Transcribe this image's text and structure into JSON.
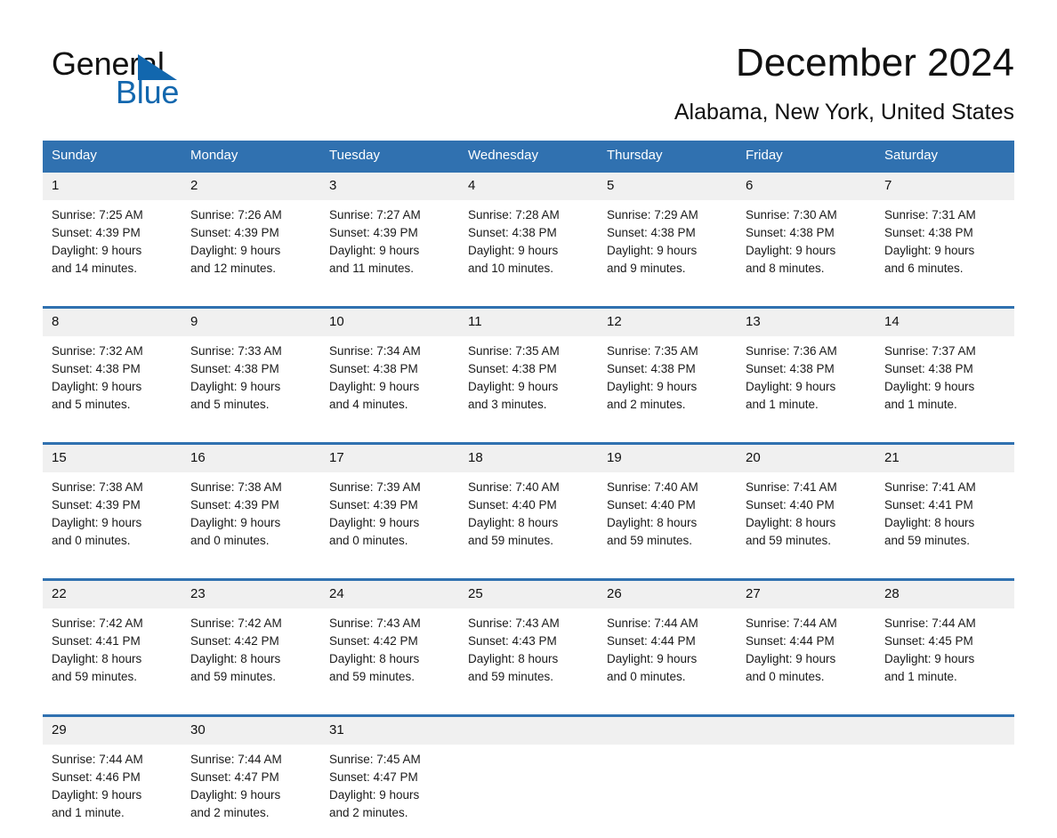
{
  "brand": {
    "name_part1": "General",
    "name_part2": "Blue",
    "triangle_color": "#1267ae"
  },
  "header": {
    "title": "December 2024",
    "subtitle": "Alabama, New York, United States"
  },
  "theme": {
    "header_blue": "#3071b0",
    "daynum_band": "#f0f0f0",
    "text": "#111111"
  },
  "weekdays": [
    "Sunday",
    "Monday",
    "Tuesday",
    "Wednesday",
    "Thursday",
    "Friday",
    "Saturday"
  ],
  "weeks": [
    [
      {
        "day": "1",
        "sunrise": "Sunrise: 7:25 AM",
        "sunset": "Sunset: 4:39 PM",
        "daylight1": "Daylight: 9 hours",
        "daylight2": "and 14 minutes."
      },
      {
        "day": "2",
        "sunrise": "Sunrise: 7:26 AM",
        "sunset": "Sunset: 4:39 PM",
        "daylight1": "Daylight: 9 hours",
        "daylight2": "and 12 minutes."
      },
      {
        "day": "3",
        "sunrise": "Sunrise: 7:27 AM",
        "sunset": "Sunset: 4:39 PM",
        "daylight1": "Daylight: 9 hours",
        "daylight2": "and 11 minutes."
      },
      {
        "day": "4",
        "sunrise": "Sunrise: 7:28 AM",
        "sunset": "Sunset: 4:38 PM",
        "daylight1": "Daylight: 9 hours",
        "daylight2": "and 10 minutes."
      },
      {
        "day": "5",
        "sunrise": "Sunrise: 7:29 AM",
        "sunset": "Sunset: 4:38 PM",
        "daylight1": "Daylight: 9 hours",
        "daylight2": "and 9 minutes."
      },
      {
        "day": "6",
        "sunrise": "Sunrise: 7:30 AM",
        "sunset": "Sunset: 4:38 PM",
        "daylight1": "Daylight: 9 hours",
        "daylight2": "and 8 minutes."
      },
      {
        "day": "7",
        "sunrise": "Sunrise: 7:31 AM",
        "sunset": "Sunset: 4:38 PM",
        "daylight1": "Daylight: 9 hours",
        "daylight2": "and 6 minutes."
      }
    ],
    [
      {
        "day": "8",
        "sunrise": "Sunrise: 7:32 AM",
        "sunset": "Sunset: 4:38 PM",
        "daylight1": "Daylight: 9 hours",
        "daylight2": "and 5 minutes."
      },
      {
        "day": "9",
        "sunrise": "Sunrise: 7:33 AM",
        "sunset": "Sunset: 4:38 PM",
        "daylight1": "Daylight: 9 hours",
        "daylight2": "and 5 minutes."
      },
      {
        "day": "10",
        "sunrise": "Sunrise: 7:34 AM",
        "sunset": "Sunset: 4:38 PM",
        "daylight1": "Daylight: 9 hours",
        "daylight2": "and 4 minutes."
      },
      {
        "day": "11",
        "sunrise": "Sunrise: 7:35 AM",
        "sunset": "Sunset: 4:38 PM",
        "daylight1": "Daylight: 9 hours",
        "daylight2": "and 3 minutes."
      },
      {
        "day": "12",
        "sunrise": "Sunrise: 7:35 AM",
        "sunset": "Sunset: 4:38 PM",
        "daylight1": "Daylight: 9 hours",
        "daylight2": "and 2 minutes."
      },
      {
        "day": "13",
        "sunrise": "Sunrise: 7:36 AM",
        "sunset": "Sunset: 4:38 PM",
        "daylight1": "Daylight: 9 hours",
        "daylight2": "and 1 minute."
      },
      {
        "day": "14",
        "sunrise": "Sunrise: 7:37 AM",
        "sunset": "Sunset: 4:38 PM",
        "daylight1": "Daylight: 9 hours",
        "daylight2": "and 1 minute."
      }
    ],
    [
      {
        "day": "15",
        "sunrise": "Sunrise: 7:38 AM",
        "sunset": "Sunset: 4:39 PM",
        "daylight1": "Daylight: 9 hours",
        "daylight2": "and 0 minutes."
      },
      {
        "day": "16",
        "sunrise": "Sunrise: 7:38 AM",
        "sunset": "Sunset: 4:39 PM",
        "daylight1": "Daylight: 9 hours",
        "daylight2": "and 0 minutes."
      },
      {
        "day": "17",
        "sunrise": "Sunrise: 7:39 AM",
        "sunset": "Sunset: 4:39 PM",
        "daylight1": "Daylight: 9 hours",
        "daylight2": "and 0 minutes."
      },
      {
        "day": "18",
        "sunrise": "Sunrise: 7:40 AM",
        "sunset": "Sunset: 4:40 PM",
        "daylight1": "Daylight: 8 hours",
        "daylight2": "and 59 minutes."
      },
      {
        "day": "19",
        "sunrise": "Sunrise: 7:40 AM",
        "sunset": "Sunset: 4:40 PM",
        "daylight1": "Daylight: 8 hours",
        "daylight2": "and 59 minutes."
      },
      {
        "day": "20",
        "sunrise": "Sunrise: 7:41 AM",
        "sunset": "Sunset: 4:40 PM",
        "daylight1": "Daylight: 8 hours",
        "daylight2": "and 59 minutes."
      },
      {
        "day": "21",
        "sunrise": "Sunrise: 7:41 AM",
        "sunset": "Sunset: 4:41 PM",
        "daylight1": "Daylight: 8 hours",
        "daylight2": "and 59 minutes."
      }
    ],
    [
      {
        "day": "22",
        "sunrise": "Sunrise: 7:42 AM",
        "sunset": "Sunset: 4:41 PM",
        "daylight1": "Daylight: 8 hours",
        "daylight2": "and 59 minutes."
      },
      {
        "day": "23",
        "sunrise": "Sunrise: 7:42 AM",
        "sunset": "Sunset: 4:42 PM",
        "daylight1": "Daylight: 8 hours",
        "daylight2": "and 59 minutes."
      },
      {
        "day": "24",
        "sunrise": "Sunrise: 7:43 AM",
        "sunset": "Sunset: 4:42 PM",
        "daylight1": "Daylight: 8 hours",
        "daylight2": "and 59 minutes."
      },
      {
        "day": "25",
        "sunrise": "Sunrise: 7:43 AM",
        "sunset": "Sunset: 4:43 PM",
        "daylight1": "Daylight: 8 hours",
        "daylight2": "and 59 minutes."
      },
      {
        "day": "26",
        "sunrise": "Sunrise: 7:44 AM",
        "sunset": "Sunset: 4:44 PM",
        "daylight1": "Daylight: 9 hours",
        "daylight2": "and 0 minutes."
      },
      {
        "day": "27",
        "sunrise": "Sunrise: 7:44 AM",
        "sunset": "Sunset: 4:44 PM",
        "daylight1": "Daylight: 9 hours",
        "daylight2": "and 0 minutes."
      },
      {
        "day": "28",
        "sunrise": "Sunrise: 7:44 AM",
        "sunset": "Sunset: 4:45 PM",
        "daylight1": "Daylight: 9 hours",
        "daylight2": "and 1 minute."
      }
    ],
    [
      {
        "day": "29",
        "sunrise": "Sunrise: 7:44 AM",
        "sunset": "Sunset: 4:46 PM",
        "daylight1": "Daylight: 9 hours",
        "daylight2": "and 1 minute."
      },
      {
        "day": "30",
        "sunrise": "Sunrise: 7:44 AM",
        "sunset": "Sunset: 4:47 PM",
        "daylight1": "Daylight: 9 hours",
        "daylight2": "and 2 minutes."
      },
      {
        "day": "31",
        "sunrise": "Sunrise: 7:45 AM",
        "sunset": "Sunset: 4:47 PM",
        "daylight1": "Daylight: 9 hours",
        "daylight2": "and 2 minutes."
      },
      {
        "day": "",
        "sunrise": "",
        "sunset": "",
        "daylight1": "",
        "daylight2": ""
      },
      {
        "day": "",
        "sunrise": "",
        "sunset": "",
        "daylight1": "",
        "daylight2": ""
      },
      {
        "day": "",
        "sunrise": "",
        "sunset": "",
        "daylight1": "",
        "daylight2": ""
      },
      {
        "day": "",
        "sunrise": "",
        "sunset": "",
        "daylight1": "",
        "daylight2": ""
      }
    ]
  ]
}
